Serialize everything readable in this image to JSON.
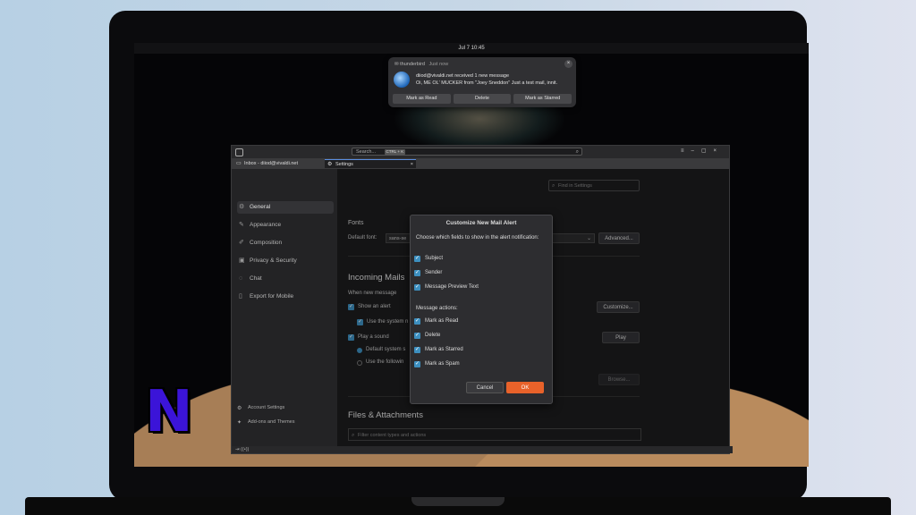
{
  "topbar": {
    "clock": "Jul 7  10:45"
  },
  "notification": {
    "app": "thunderbird",
    "time": "Just now",
    "line1": "diiod@vivaldi.net received 1 new message",
    "line2": "Oi, ME OL' MUCKER from \"Joey Sneddon\"  Just a test mail, innit.",
    "actions": [
      "Mark as Read",
      "Delete",
      "Mark as Starred"
    ]
  },
  "window": {
    "search_placeholder": "Search...",
    "search_shortcut": "CTRL + K",
    "tabs": [
      "Inbox - diiod@vivaldi.net",
      "Settings"
    ]
  },
  "sidebar": {
    "items": [
      "General",
      "Appearance",
      "Composition",
      "Privacy & Security",
      "Chat",
      "Export for Mobile"
    ],
    "footer": [
      "Account Settings",
      "Add-ons and Themes"
    ]
  },
  "settings": {
    "find_placeholder": "Find in Settings",
    "fonts_heading": "Fonts",
    "default_font_label": "Default font:",
    "default_font_value": "sans-se",
    "advanced_button": "Advanced...",
    "incoming_heading": "Incoming Mails",
    "when_new": "When new message",
    "show_alert": "Show an alert",
    "use_system": "Use the system n",
    "customize_button": "Customize...",
    "play_sound": "Play a sound",
    "play_button": "Play",
    "default_system": "Default system s",
    "use_following": "Use the followin",
    "browse_button": "Browse...",
    "files_heading": "Files & Attachments",
    "filter_placeholder": "Filter content types and actions"
  },
  "dialog": {
    "title": "Customize New Mail Alert",
    "description": "Choose which fields to show in the alert notification:",
    "fields": [
      "Subject",
      "Sender",
      "Message Preview Text"
    ],
    "actions_heading": "Message actions:",
    "actions": [
      "Mark as Read",
      "Delete",
      "Mark as Starred",
      "Mark as Spam"
    ],
    "cancel": "Cancel",
    "ok": "OK"
  },
  "logo": {
    "letter": "N"
  },
  "colors": {
    "accent": "#e8622a",
    "checkbox": "#3d8fbf",
    "logo": "#3b14d8"
  }
}
